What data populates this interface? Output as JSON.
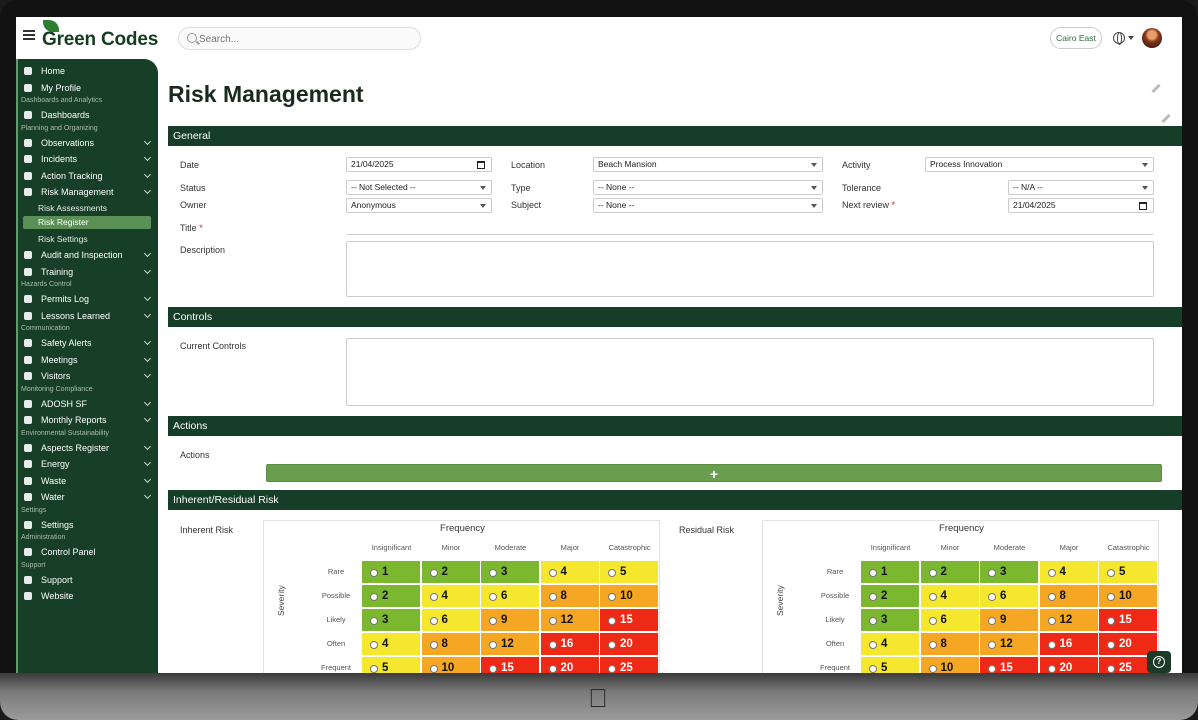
{
  "app": {
    "logo": "Green Codes",
    "search_placeholder": "Search...",
    "site": "Cairo East"
  },
  "sidebar": {
    "items": [
      {
        "label": "Home",
        "icon": "home-icon"
      },
      {
        "label": "My Profile",
        "icon": "user-icon"
      },
      {
        "category": "Dashboards and Analytics"
      },
      {
        "label": "Dashboards",
        "icon": "pie-chart-icon"
      },
      {
        "category": "Planning and Organizing"
      },
      {
        "label": "Observations",
        "icon": "eye-icon"
      },
      {
        "label": "Incidents",
        "icon": "briefcase-icon"
      },
      {
        "label": "Action Tracking",
        "icon": "arrow-icon"
      },
      {
        "label": "Risk Management",
        "icon": "warning-icon"
      },
      {
        "sub": "Risk Assessments"
      },
      {
        "sub_active": "Risk Register"
      },
      {
        "sub": "Risk Settings"
      },
      {
        "label": "Audit and Inspection",
        "icon": "hammer-icon"
      },
      {
        "label": "Training",
        "icon": "chart-line-icon"
      },
      {
        "category": "Hazards Control"
      },
      {
        "label": "Permits Log",
        "icon": "file-icon"
      },
      {
        "label": "Lessons Learned",
        "icon": "lightbulb-icon"
      },
      {
        "category": "Communication"
      },
      {
        "label": "Safety Alerts",
        "icon": "megaphone-icon"
      },
      {
        "label": "Meetings",
        "icon": "people-icon"
      },
      {
        "label": "Visitors",
        "icon": "person-icon"
      },
      {
        "category": "Monitoring Compliance"
      },
      {
        "label": "ADOSH SF",
        "icon": "folder-icon"
      },
      {
        "label": "Monthly Reports",
        "icon": "calendar-icon"
      },
      {
        "category": "Environmental Sustainability"
      },
      {
        "label": "Aspects Register",
        "icon": "globe-icon"
      },
      {
        "label": "Energy",
        "icon": "flame-icon"
      },
      {
        "label": "Waste",
        "icon": "trash-icon"
      },
      {
        "label": "Water",
        "icon": "water-icon"
      },
      {
        "category": "Settings"
      },
      {
        "label": "Settings",
        "icon": "gear-icon"
      },
      {
        "category": "Administration"
      },
      {
        "label": "Control Panel",
        "icon": "control-icon"
      },
      {
        "category": "Support"
      },
      {
        "label": "Support",
        "icon": "support-icon"
      },
      {
        "label": "Website",
        "icon": "globe-icon"
      }
    ]
  },
  "page": {
    "title": "Risk Management"
  },
  "general": {
    "section": "General",
    "date_label": "Date",
    "date_value": "21/04/2025",
    "location_label": "Location",
    "location_value": "Beach Mansion",
    "activity_label": "Activity",
    "activity_value": "Process Innovation",
    "status_label": "Status",
    "status_value": "-- Not Selected --",
    "type_label": "Type",
    "type_value": "-- None --",
    "tolerance_label": "Tolerance",
    "tolerance_value": "-- N/A --",
    "owner_label": "Owner",
    "owner_value": "Anonymous",
    "subject_label": "Subject",
    "subject_value": "-- None --",
    "next_review_label": "Next review",
    "next_review_value": "21/04/2025",
    "title_label": "Title",
    "description_label": "Description",
    "required_mark": "*"
  },
  "controls": {
    "section": "Controls",
    "current_label": "Current Controls"
  },
  "actions": {
    "section": "Actions",
    "label": "Actions",
    "add": "+"
  },
  "risk": {
    "section": "Inherent/Residual Risk",
    "inherent_label": "Inherent Risk",
    "residual_label": "Residual Risk",
    "frequency": "Frequency",
    "severity": "Severity",
    "columns": [
      "Insignificant",
      "Minor",
      "Moderate",
      "Major",
      "Catastrophic"
    ],
    "rows": [
      "Rare",
      "Possible",
      "Likely",
      "Often",
      "Frequent"
    ],
    "values": [
      [
        1,
        2,
        3,
        4,
        5
      ],
      [
        2,
        4,
        6,
        8,
        10
      ],
      [
        3,
        6,
        9,
        12,
        15
      ],
      [
        4,
        8,
        12,
        16,
        20
      ],
      [
        5,
        10,
        15,
        20,
        25
      ]
    ],
    "colors": [
      [
        "g",
        "g",
        "g",
        "y",
        "y"
      ],
      [
        "g",
        "y",
        "y",
        "o",
        "o"
      ],
      [
        "g",
        "y",
        "o",
        "o",
        "r"
      ],
      [
        "y",
        "o",
        "o",
        "r",
        "r"
      ],
      [
        "y",
        "o",
        "r",
        "r",
        "r"
      ]
    ]
  }
}
